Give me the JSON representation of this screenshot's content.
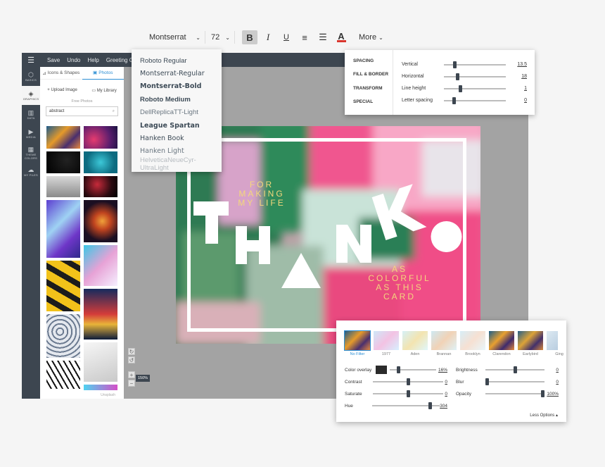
{
  "toolbar": {
    "font": "Montserrat",
    "size": "72",
    "bold": "B",
    "italic": "I",
    "underline": "U",
    "more": "More",
    "color_underline": "#d9362e"
  },
  "topbar": {
    "items": [
      "Save",
      "Undo",
      "Help",
      "Greeting Card 2"
    ]
  },
  "iconbar": [
    {
      "glyph": "⬡",
      "label": "BASICS"
    },
    {
      "glyph": "◈",
      "label": "GRAPHICS"
    },
    {
      "glyph": "▥",
      "label": "DATA"
    },
    {
      "glyph": "▶",
      "label": "MEDIA"
    },
    {
      "glyph": "▦",
      "label": "THEME COLORS"
    },
    {
      "glyph": "☁",
      "label": "MY FILES"
    }
  ],
  "panel": {
    "tab_icons": "Icons & Shapes",
    "tab_photos": "Photos",
    "upload": "Upload Image",
    "library": "My Library",
    "free_photos": "Free Photos",
    "search_value": "abstract",
    "credit": "Unsplash"
  },
  "font_dropdown": [
    {
      "name": "Roboto Regular",
      "weight": "normal",
      "family": "\"Liberation Sans\", sans-serif",
      "color": "#3c4a56"
    },
    {
      "name": "Montserrat-Regular",
      "weight": "normal",
      "family": "\"DejaVu Sans\", sans-serif",
      "color": "#3c4a56"
    },
    {
      "name": "Montserrat-Bold",
      "weight": "bold",
      "family": "\"DejaVu Sans\", sans-serif",
      "color": "#3c4a56"
    },
    {
      "name": "Roboto Medium",
      "weight": "bold",
      "family": "\"Liberation Sans\", sans-serif",
      "color": "#3c4a56"
    },
    {
      "name": "DellReplicaTT-Light",
      "weight": "normal",
      "family": "\"Liberation Sans\", sans-serif",
      "color": "#6a7680"
    },
    {
      "name": "League Spartan",
      "weight": "bold",
      "family": "\"DejaVu Sans\", sans-serif",
      "color": "#3c4a56"
    },
    {
      "name": "Hanken Book",
      "weight": "normal",
      "family": "\"DejaVu Sans\", sans-serif",
      "color": "#3c4a56"
    },
    {
      "name": "Hanken Light",
      "weight": "normal",
      "family": "\"DejaVu Sans\", sans-serif",
      "color": "#6a7680"
    },
    {
      "name": "HelveticaNeueCyr-UltraLight",
      "weight": "normal",
      "family": "\"Liberation Sans\", sans-serif",
      "color": "#b7bcc1"
    }
  ],
  "spacing": {
    "tabs": [
      "SPACING",
      "FILL & BORDER",
      "TRANSFORM",
      "SPECIAL"
    ],
    "rows": [
      {
        "label": "Vertical",
        "value": "13.5",
        "level": 0.16
      },
      {
        "label": "Horizontal",
        "value": "18",
        "level": 0.2
      },
      {
        "label": "Line height",
        "value": "1",
        "level": 0.25
      },
      {
        "label": "Letter spacing",
        "value": "0",
        "level": 0.14
      }
    ]
  },
  "card": {
    "left_text": [
      "FOR",
      "MAKING",
      "MY LIFE"
    ],
    "right_text": [
      "AS",
      "COLORFUL",
      "AS THIS",
      "CARD"
    ]
  },
  "zoom": {
    "label": "150%"
  },
  "filter": {
    "filters": [
      "No Filter",
      "1977",
      "Aden",
      "Brannan",
      "Brooklyn",
      "Clarendon",
      "Earlybird",
      "Ging"
    ],
    "left_rows": [
      {
        "label": "Color overlay",
        "value": "16%",
        "level": 0.16,
        "swatch": true
      },
      {
        "label": "Contrast",
        "value": "0",
        "level": 0.5
      },
      {
        "label": "Saturate",
        "value": "0",
        "level": 0.5
      },
      {
        "label": "Hue",
        "value": "304",
        "level": 0.84
      }
    ],
    "right_rows": [
      {
        "label": "Brightness",
        "value": "0",
        "level": 0.5
      },
      {
        "label": "Blur",
        "value": "0",
        "level": 0.0
      },
      {
        "label": "Opacity",
        "value": "100%",
        "level": 1.0
      }
    ],
    "less": "Less Options"
  }
}
